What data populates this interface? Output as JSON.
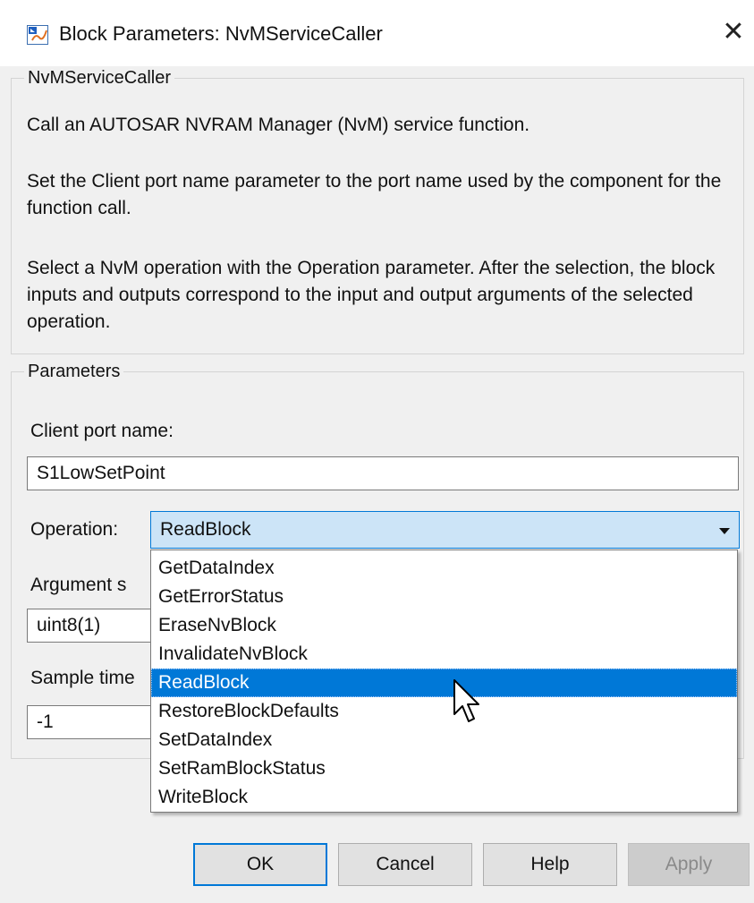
{
  "window": {
    "title": "Block Parameters: NvMServiceCaller"
  },
  "description": {
    "legend": "NvMServiceCaller",
    "paragraphs": [
      "Call an AUTOSAR NVRAM Manager (NvM) service function.",
      "Set the Client port name parameter to the port name used by the component for the function call.",
      "Select a NvM operation with the Operation parameter.  After the selection, the block inputs and outputs correspond to the input and output arguments of the selected operation."
    ]
  },
  "parameters": {
    "legend": "Parameters",
    "client_port": {
      "label": "Client port name:",
      "value": "S1LowSetPoint"
    },
    "operation": {
      "label": "Operation:",
      "value": "ReadBlock",
      "options": [
        "GetDataIndex",
        "GetErrorStatus",
        "EraseNvBlock",
        "InvalidateNvBlock",
        "ReadBlock",
        "RestoreBlockDefaults",
        "SetDataIndex",
        "SetRamBlockStatus",
        "WriteBlock"
      ]
    },
    "argument": {
      "label": "Argument s",
      "value": "uint8(1)"
    },
    "sample_time": {
      "label": "Sample time",
      "value": "-1"
    }
  },
  "buttons": {
    "ok": "OK",
    "cancel": "Cancel",
    "help": "Help",
    "apply": "Apply"
  },
  "icons": {
    "app": "simulink-block-icon",
    "close": "close-icon",
    "dropdown": "chevron-down-icon",
    "cursor": "mouse-pointer-icon"
  },
  "colors": {
    "selection": "#0078d7",
    "combo_highlight": "#cce4f7",
    "disabled_button": "#cccccc"
  }
}
